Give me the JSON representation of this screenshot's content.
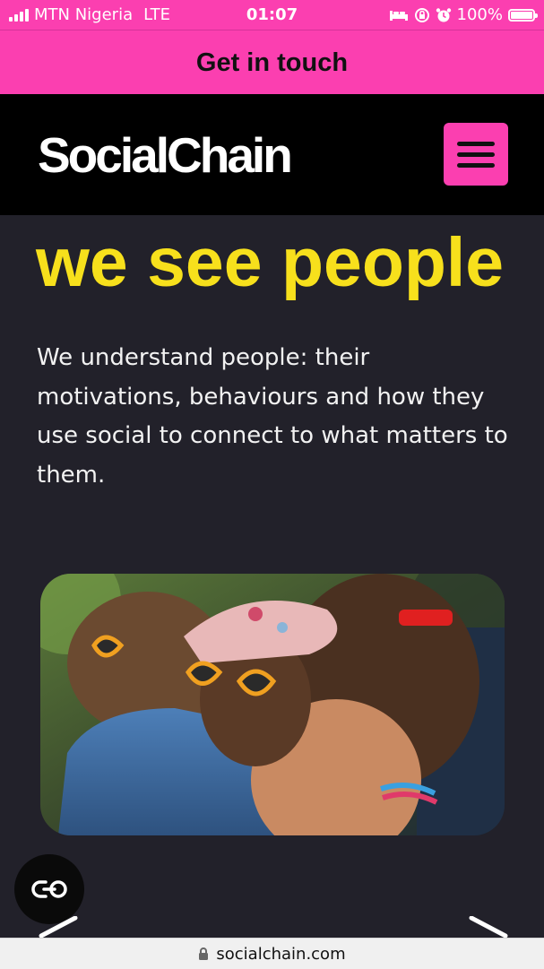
{
  "status_bar": {
    "carrier": "MTN Nigeria",
    "network": "LTE",
    "time": "01:07",
    "battery": "100%",
    "icons": [
      "signal-icon",
      "bed-icon",
      "screen-lock-icon",
      "alarm-icon",
      "battery-icon"
    ]
  },
  "cta": {
    "label": "Get in touch"
  },
  "header": {
    "logo": "SocialChain",
    "menu_icon": "hamburger-menu-icon"
  },
  "main": {
    "headline": "we see people",
    "intro": "We understand people: their motivations, behaviours and how they use social to connect to what matters to them.",
    "image_icon": "photo-two-people-hugging"
  },
  "floating": {
    "chat_icon": "chat-link-icon"
  },
  "carousel": {
    "prev_icon": "chevron-left-icon",
    "next_icon": "chevron-right-icon"
  },
  "browser": {
    "url": "socialchain.com",
    "lock_icon": "lock-icon"
  },
  "colors": {
    "accent_pink": "#fb3fb0",
    "headline_yellow": "#f7e01c",
    "background": "#22212a",
    "header_black": "#000000"
  }
}
